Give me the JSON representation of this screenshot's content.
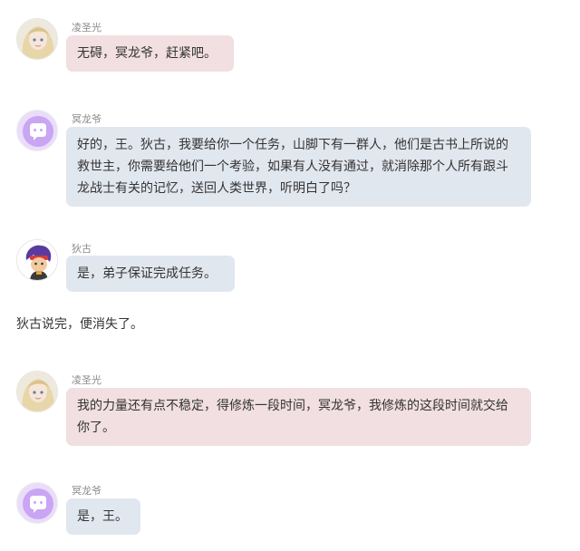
{
  "colors": {
    "bubble_pink": "#f1dfe1",
    "bubble_blue": "#e1e7ef",
    "name_gray": "#8a8a8a",
    "text": "#333333",
    "bot_avatar_bg": "#c9a5f3"
  },
  "messages": [
    {
      "speaker": "凌圣光",
      "avatar_icon": "anime-girl-avatar-icon",
      "text": "无碍，冥龙爷，赶紧吧。"
    },
    {
      "speaker": "冥龙爷",
      "avatar_icon": "chat-bubble-avatar-icon",
      "text": "好的，王。狄古，我要给你一个任务，山脚下有一群人，他们是古书上所说的救世主，你需要给他们一个考验，如果有人没有通过，就消除那个人所有跟斗龙战士有关的记忆，送回人类世界，听明白了吗？"
    },
    {
      "speaker": "狄古",
      "avatar_icon": "cartoon-boy-avatar-icon",
      "text": "是，弟子保证完成任务。"
    },
    {
      "speaker": "凌圣光",
      "avatar_icon": "anime-girl-avatar-icon",
      "text": "我的力量还有点不稳定，得修炼一段时间，冥龙爷，我修炼的这段时间就交给你了。"
    },
    {
      "speaker": "冥龙爷",
      "avatar_icon": "chat-bubble-avatar-icon",
      "text": "是，王。"
    }
  ],
  "narration": "狄古说完，便消失了。"
}
